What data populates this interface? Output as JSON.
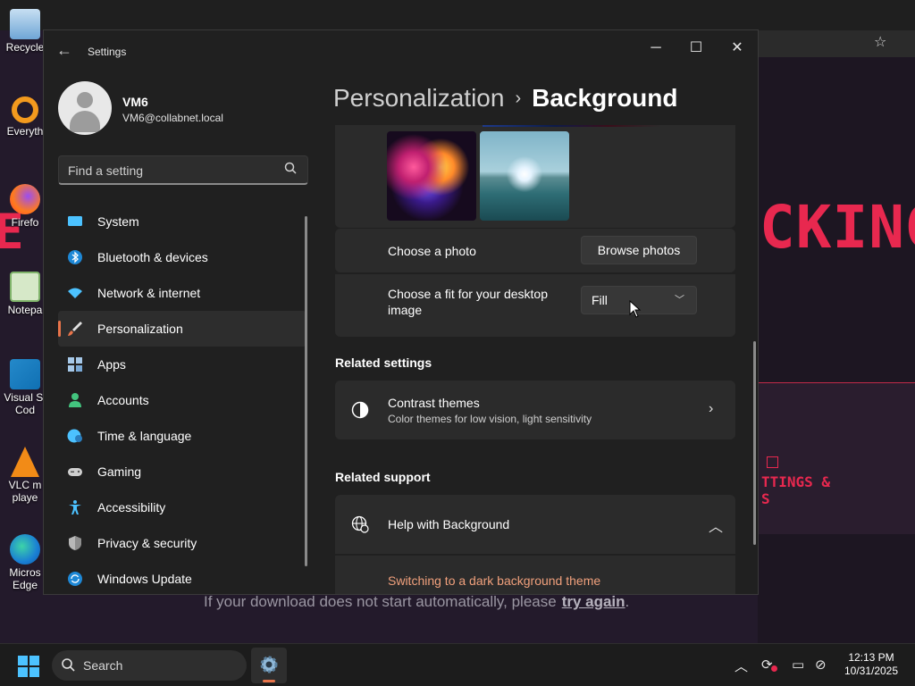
{
  "desktop": {
    "icons": [
      {
        "name": "recycle-bin",
        "label": "Recycle"
      },
      {
        "name": "everything",
        "label": "Everyth"
      },
      {
        "name": "firefox",
        "label": "Firefo"
      },
      {
        "name": "notepad",
        "label": "Notepa"
      },
      {
        "name": "vscode",
        "label": "Visual St\nCod"
      },
      {
        "name": "vlc",
        "label": "VLC m\nplaye"
      },
      {
        "name": "edge",
        "label": "Micros\nEdge"
      }
    ],
    "hero_text": "CKING",
    "hero_left_text": "E",
    "side_text": "TTINGS &\nS",
    "download_note": "If your download does not start automatically, please",
    "download_link": "try again",
    "download_period": "."
  },
  "window": {
    "app_title": "Settings",
    "profile": {
      "name": "VM6",
      "email": "VM6@collabnet.local"
    },
    "search": {
      "placeholder": "Find a setting"
    },
    "nav": [
      {
        "label": "System",
        "icon": "monitor-icon",
        "color": "#4cc2ff",
        "selected": false
      },
      {
        "label": "Bluetooth & devices",
        "icon": "bluetooth-icon",
        "color": "#4cc2ff",
        "selected": false
      },
      {
        "label": "Network & internet",
        "icon": "wifi-icon",
        "color": "#4cc2ff",
        "selected": false
      },
      {
        "label": "Personalization",
        "icon": "paintbrush-icon",
        "color": "#e8744a",
        "selected": true
      },
      {
        "label": "Apps",
        "icon": "apps-icon",
        "color": "#a6c8e8",
        "selected": false
      },
      {
        "label": "Accounts",
        "icon": "person-icon",
        "color": "#43c47e",
        "selected": false
      },
      {
        "label": "Time & language",
        "icon": "globe-clock-icon",
        "color": "#4cc2ff",
        "selected": false
      },
      {
        "label": "Gaming",
        "icon": "gamepad-icon",
        "color": "#cfcfcf",
        "selected": false
      },
      {
        "label": "Accessibility",
        "icon": "accessibility-icon",
        "color": "#4cc2ff",
        "selected": false
      },
      {
        "label": "Privacy & security",
        "icon": "shield-icon",
        "color": "#b8b8b8",
        "selected": false
      },
      {
        "label": "Windows Update",
        "icon": "update-icon",
        "color": "#4cc2ff",
        "selected": false
      }
    ],
    "breadcrumb": {
      "parent": "Personalization",
      "separator": "›",
      "current": "Background"
    },
    "background": {
      "choose_photo_label": "Choose a photo",
      "browse_button": "Browse photos",
      "fit_label": "Choose a fit for your desktop image",
      "fit_value": "Fill"
    },
    "related_settings": {
      "heading": "Related settings",
      "contrast_title": "Contrast themes",
      "contrast_sub": "Color themes for low vision, light sensitivity"
    },
    "related_support": {
      "heading": "Related support",
      "help_title": "Help with Background",
      "link": "Switching to a dark background theme"
    }
  },
  "taskbar": {
    "search_label": "Search",
    "time": "12:13 PM",
    "date": "10/31/2025"
  },
  "colors": {
    "accent": "#e8744a",
    "link": "#f0a07c",
    "brand_red": "#e8284f"
  }
}
